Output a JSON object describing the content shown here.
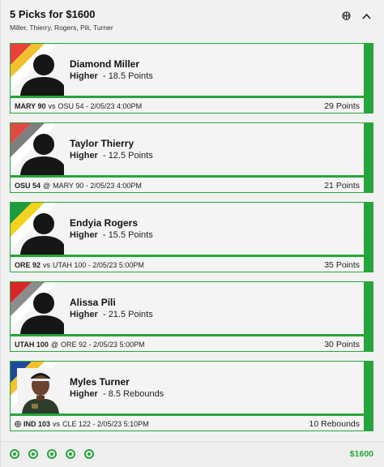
{
  "header": {
    "title": "5 Picks for $1600",
    "subtitle": "Miller, Thierry, Rogers, Pili, Turner"
  },
  "colors": {
    "accent": "#26a53c"
  },
  "picks": [
    {
      "name": "Diamond Miller",
      "direction": "Higher",
      "line": "- 18.5 Points",
      "team": "MARY 90",
      "sep": "vs",
      "opponent": "OSU 54 - 2/05/23 4:00PM",
      "result": "29 Points",
      "stripes": [
        "#e8413a",
        "#f2c12e"
      ],
      "has_photo": false
    },
    {
      "name": "Taylor Thierry",
      "direction": "Higher",
      "line": "- 12.5 Points",
      "team": "OSU 54",
      "sep": "@",
      "opponent": "MARY 90 - 2/05/23 4:00PM",
      "result": "21 Points",
      "stripes": [
        "#e04a45",
        "#7f7f7f"
      ],
      "has_photo": false
    },
    {
      "name": "Endyia Rogers",
      "direction": "Higher",
      "line": "- 15.5 Points",
      "team": "ORE 92",
      "sep": "vs",
      "opponent": "UTAH 100 - 2/05/23 5:00PM",
      "result": "35 Points",
      "stripes": [
        "#1e9b3c",
        "#f4d21f"
      ],
      "has_photo": false
    },
    {
      "name": "Alissa Pili",
      "direction": "Higher",
      "line": "- 21.5 Points",
      "team": "UTAH 100",
      "sep": "@",
      "opponent": "ORE 92 - 2/05/23 5:00PM",
      "result": "30 Points",
      "stripes": [
        "#d9252a",
        "#8c8c8c"
      ],
      "has_photo": false
    },
    {
      "name": "Myles Turner",
      "direction": "Higher",
      "line": "- 8.5 Rebounds",
      "team": "IND 103",
      "sep": "vs",
      "opponent": "CLE 122 - 2/05/23 5:10PM",
      "result": "10 Rebounds",
      "stripes": [
        "#1d4a9b",
        "#f4c22c"
      ],
      "has_photo": true
    }
  ],
  "footer": {
    "total": "$1600",
    "dot_count": 5
  },
  "icons": {
    "basketball": "basketball-icon",
    "collapse": "chevron-up-icon"
  }
}
